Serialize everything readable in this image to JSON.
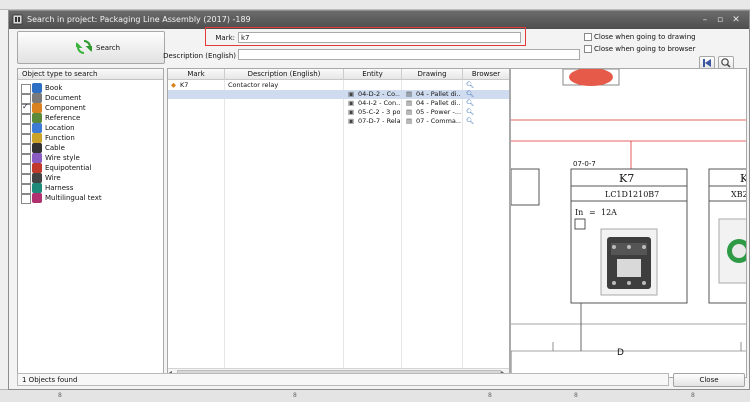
{
  "window": {
    "title": "Search in project: Packaging Line Assembly (2017) -189"
  },
  "search": {
    "button_label": "Search",
    "mark_label": "Mark:",
    "mark_value": "k7",
    "description_label": "Description (English)",
    "description_value": "",
    "close_when_drawing_label": "Close when going to drawing",
    "close_when_browser_label": "Close when going to browser"
  },
  "object_types": {
    "header": "Object type to search",
    "items": [
      {
        "label": "Book",
        "checked": false,
        "icon": "book-icon"
      },
      {
        "label": "Document",
        "checked": false,
        "icon": "document-icon"
      },
      {
        "label": "Component",
        "checked": true,
        "icon": "component-icon"
      },
      {
        "label": "Reference",
        "checked": false,
        "icon": "reference-icon"
      },
      {
        "label": "Location",
        "checked": false,
        "icon": "location-icon"
      },
      {
        "label": "Function",
        "checked": false,
        "icon": "function-icon"
      },
      {
        "label": "Cable",
        "checked": false,
        "icon": "cable-icon"
      },
      {
        "label": "Wire style",
        "checked": false,
        "icon": "wire-style-icon"
      },
      {
        "label": "Equipotential",
        "checked": false,
        "icon": "equipotential-icon"
      },
      {
        "label": "Wire",
        "checked": false,
        "icon": "wire-icon"
      },
      {
        "label": "Harness",
        "checked": false,
        "icon": "harness-icon"
      },
      {
        "label": "Multilingual text",
        "checked": false,
        "icon": "multilingual-text-icon"
      }
    ]
  },
  "results": {
    "columns": [
      "Mark",
      "Description (English)",
      "Entity",
      "Drawing",
      "Browser"
    ],
    "rows": [
      {
        "mark": "K7",
        "description": "Contactor relay",
        "entity": "",
        "drawing": ""
      },
      {
        "mark": "",
        "description": "",
        "entity": "04-D-2 - Co...",
        "drawing": "04 - Pallet di..."
      },
      {
        "mark": "",
        "description": "",
        "entity": "04-I-2 - Con...",
        "drawing": "04 - Pallet di..."
      },
      {
        "mark": "",
        "description": "",
        "entity": "05-C-2 - 3 po...",
        "drawing": "05 - Power -..."
      },
      {
        "mark": "",
        "description": "",
        "entity": "07-D-7 - Rela...",
        "drawing": "07 - Comma..."
      }
    ]
  },
  "preview": {
    "ref_label": "07-0-7",
    "component_mark": "K7",
    "component_ref": "LC1D1210B7",
    "current_label": "In",
    "current_eq": "=",
    "current_value": "12A",
    "neighbor_mark": "K",
    "neighbor_ref": "XB2",
    "column_letter": "D"
  },
  "status": {
    "text": "1 Objects found",
    "close_label": "Close"
  },
  "background": {
    "tick_marks": [
      "8",
      "8",
      "8",
      "8",
      "8"
    ]
  }
}
